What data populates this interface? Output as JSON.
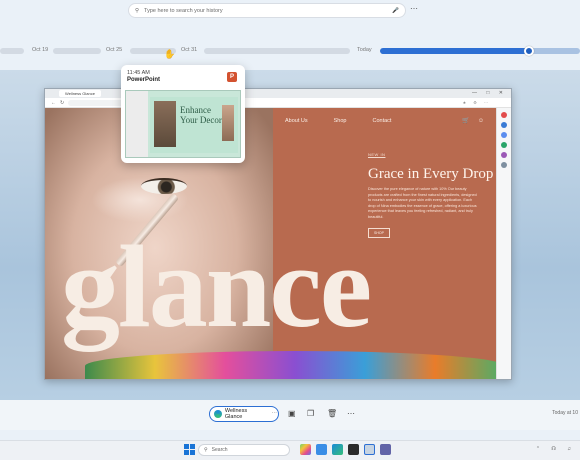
{
  "search": {
    "placeholder": "Type here to search your history"
  },
  "timeline": {
    "labels": [
      "Oct 19",
      "Oct 25",
      "Oct 31",
      "Today"
    ],
    "position_fraction": 0.87
  },
  "preview": {
    "time": "11:45 AM",
    "app": "PowerPoint",
    "app_icon": "P",
    "slide_title": "Enhance\nYour Decor"
  },
  "browser": {
    "tab_label": "Wellness Glance",
    "site": {
      "nav": [
        "About Us",
        "Shop",
        "Contact"
      ],
      "kicker": "NEW IN",
      "headline": "Grace in Every Drop",
      "body": "Discover the pure elegance of nature with 10% Our beauty products are crafted from the finest natural ingredients, designed to nourish and enhance your skin with every application. Each drop of Nina embodies the essence of grace, offering a luxurious experience that leaves you feeling refreshed, radiant, and truly beautiful.",
      "shop_button": "SHOP",
      "big_word": "glance"
    }
  },
  "controls": {
    "pill_label": "Wellness Glance",
    "today_label": "Today at 10"
  },
  "taskbar": {
    "search_label": "Search"
  },
  "colors": {
    "accent": "#2d6fd3",
    "site_bg": "#b86a4f",
    "ppt": "#d35230"
  }
}
